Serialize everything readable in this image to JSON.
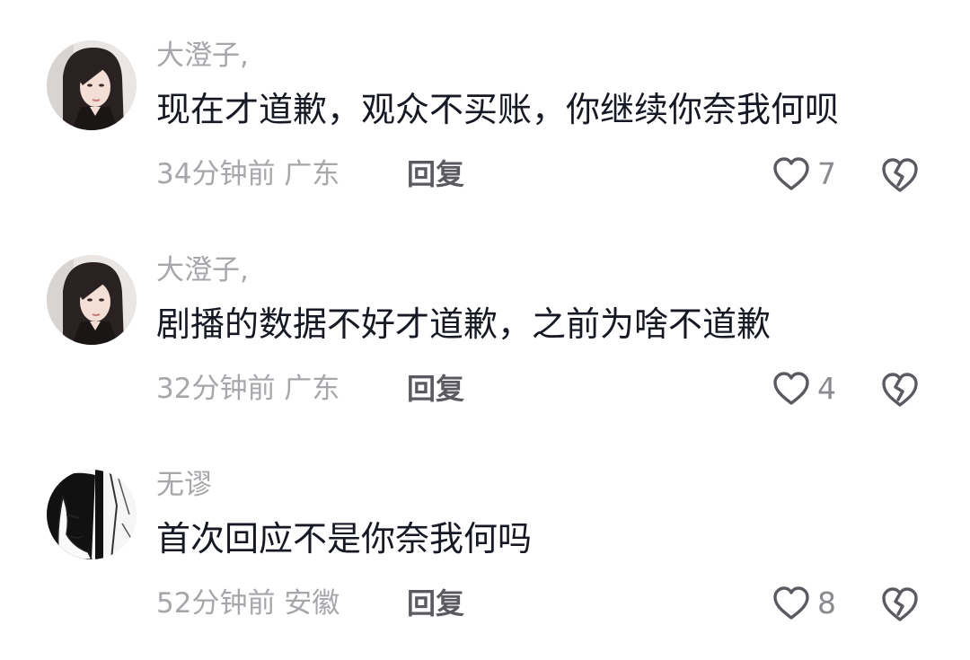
{
  "comments": [
    {
      "username": "大澄子,",
      "content": "现在才道歉，观众不买账，你继续你奈我何呗",
      "meta": "34分钟前 广东",
      "reply_label": "回复",
      "like_count": "7",
      "avatar": "woman-photo-avatar"
    },
    {
      "username": "大澄子,",
      "content": "剧播的数据不好才道歉，之前为啥不道歉",
      "meta": "32分钟前 广东",
      "reply_label": "回复",
      "like_count": "4",
      "avatar": "woman-photo-avatar"
    },
    {
      "username": "无谬",
      "content": "首次回应不是你奈我何吗",
      "meta": "52分钟前 安徽",
      "reply_label": "回复",
      "like_count": "8",
      "avatar": "manga-sketch-avatar"
    }
  ],
  "colors": {
    "text_primary": "#161823",
    "text_secondary": "#a7a7ab",
    "reply": "#5a5a60",
    "icon": "#5a5a60"
  },
  "icons": {
    "like": "heart-outline-icon",
    "dislike": "broken-heart-icon"
  }
}
